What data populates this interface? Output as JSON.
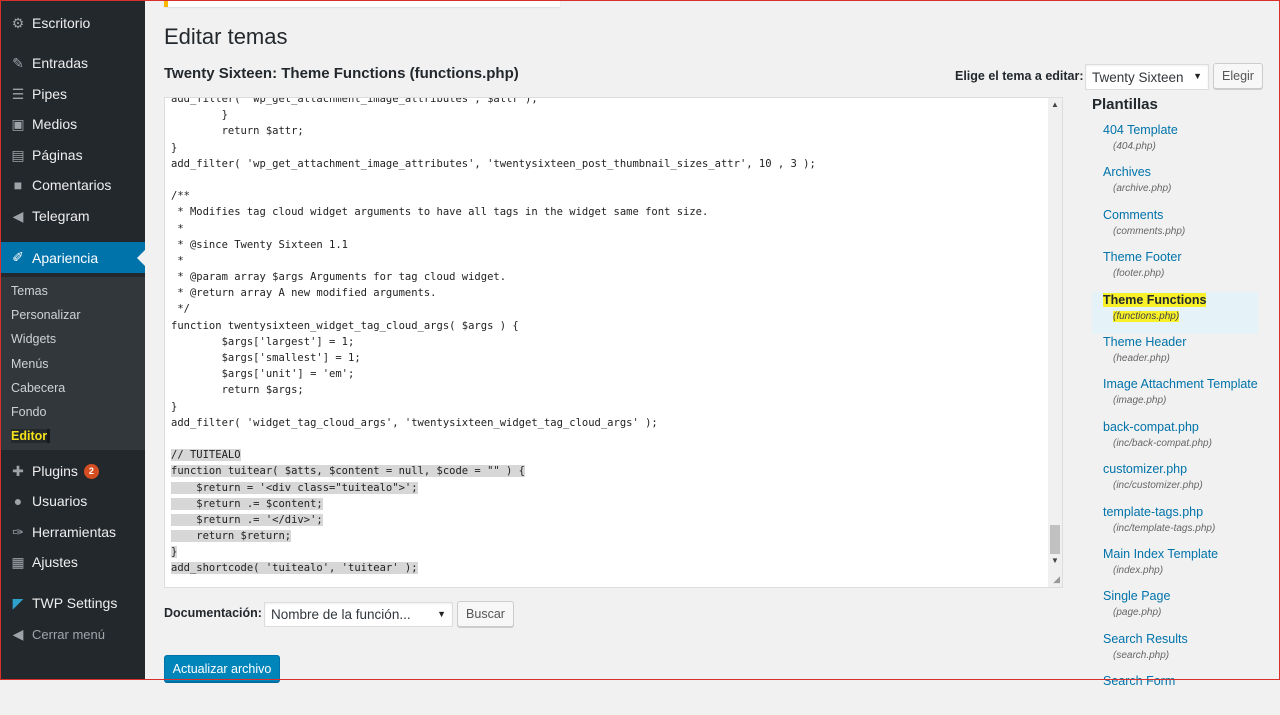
{
  "sidebar": {
    "items": [
      {
        "label": "Escritorio",
        "icon": "dashboard-icon",
        "glyph": "⚙"
      },
      {
        "label": "Entradas",
        "icon": "pin-icon",
        "glyph": "✎"
      },
      {
        "label": "Pipes",
        "icon": "menu-icon",
        "glyph": "☰"
      },
      {
        "label": "Medios",
        "icon": "media-icon",
        "glyph": "▣"
      },
      {
        "label": "Páginas",
        "icon": "pages-icon",
        "glyph": "▤"
      },
      {
        "label": "Comentarios",
        "icon": "comment-icon",
        "glyph": "■"
      },
      {
        "label": "Telegram",
        "icon": "megaphone-icon",
        "glyph": "◀"
      },
      {
        "label": "Apariencia",
        "icon": "brush-icon",
        "glyph": "✐"
      }
    ],
    "submenu": [
      "Temas",
      "Personalizar",
      "Widgets",
      "Menús",
      "Cabecera",
      "Fondo",
      "Editor"
    ],
    "items_after": [
      {
        "label": "Plugins",
        "icon": "plugin-icon",
        "glyph": "✚",
        "badge": "2"
      },
      {
        "label": "Usuarios",
        "icon": "user-icon",
        "glyph": "●"
      },
      {
        "label": "Herramientas",
        "icon": "wrench-icon",
        "glyph": "✑"
      },
      {
        "label": "Ajustes",
        "icon": "settings-icon",
        "glyph": "▦"
      },
      {
        "label": "TWP Settings",
        "icon": "telegram-icon",
        "glyph": "◤"
      },
      {
        "label": "Cerrar menú",
        "icon": "collapse-icon",
        "glyph": "◀"
      }
    ]
  },
  "page": {
    "title": "Editar temas",
    "file_title": "Twenty Sixteen: Theme Functions (functions.php)",
    "theme_select_label": "Elige el tema a editar:",
    "theme_selected": "Twenty Sixteen",
    "choose_button": "Elegir"
  },
  "editor": {
    "lines": [
      "add_filter( 'wp_get_attachment_image_attributes', $attr );",
      "\t}",
      "\treturn $attr;",
      "}",
      "add_filter( 'wp_get_attachment_image_attributes', 'twentysixteen_post_thumbnail_sizes_attr', 10 , 3 );",
      "",
      "/**",
      " * Modifies tag cloud widget arguments to have all tags in the widget same font size.",
      " *",
      " * @since Twenty Sixteen 1.1",
      " *",
      " * @param array $args Arguments for tag cloud widget.",
      " * @return array A new modified arguments.",
      " */",
      "function twentysixteen_widget_tag_cloud_args( $args ) {",
      "\t$args['largest'] = 1;",
      "\t$args['smallest'] = 1;",
      "\t$args['unit'] = 'em';",
      "\treturn $args;",
      "}",
      "add_filter( 'widget_tag_cloud_args', 'twentysixteen_widget_tag_cloud_args' );",
      "",
      "// TUITEALO",
      "function tuitear( $atts, $content = null, $code = \"\" ) {",
      "    $return = '<div class=\"tuitealo\">';",
      "    $return .= $content;",
      "    $return .= '</div>';",
      "    return $return;",
      "}",
      "add_shortcode( 'tuitealo', 'tuitear' );"
    ],
    "selected_from_line": 22
  },
  "templates": {
    "heading": "Plantillas",
    "items": [
      {
        "name": "404 Template",
        "file": "(404.php)"
      },
      {
        "name": "Archives",
        "file": "(archive.php)"
      },
      {
        "name": "Comments",
        "file": "(comments.php)"
      },
      {
        "name": "Theme Footer",
        "file": "(footer.php)"
      },
      {
        "name": "Theme Functions",
        "file": "(functions.php)",
        "current": true
      },
      {
        "name": "Theme Header",
        "file": "(header.php)"
      },
      {
        "name": "Image Attachment Template",
        "file": "(image.php)"
      },
      {
        "name": "back-compat.php",
        "file": "(inc/back-compat.php)"
      },
      {
        "name": "customizer.php",
        "file": "(inc/customizer.php)"
      },
      {
        "name": "template-tags.php",
        "file": "(inc/template-tags.php)"
      },
      {
        "name": "Main Index Template",
        "file": "(index.php)"
      },
      {
        "name": "Single Page",
        "file": "(page.php)"
      },
      {
        "name": "Search Results",
        "file": "(search.php)"
      },
      {
        "name": "Search Form",
        "file": ""
      }
    ]
  },
  "documentation": {
    "label": "Documentación:",
    "placeholder": "Nombre de la función...",
    "search_button": "Buscar"
  },
  "update_button": "Actualizar archivo",
  "colors": {
    "sidebar": "#23282d",
    "accent": "#0073aa",
    "highlight": "#f8f12a"
  }
}
